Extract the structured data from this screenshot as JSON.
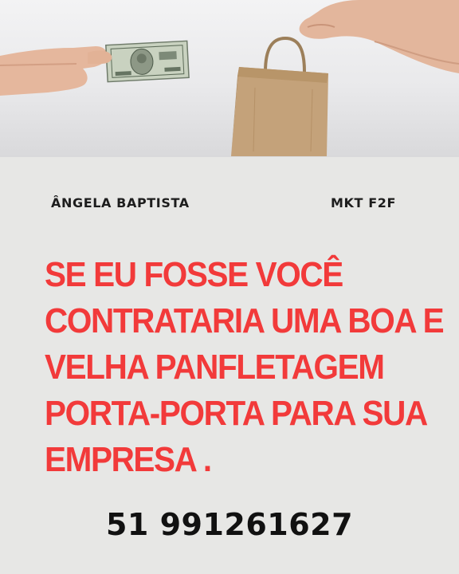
{
  "header_photo": {
    "description_icons": [
      "hand-with-banknote-icon",
      "hand-with-shopping-bag-icon"
    ]
  },
  "names": {
    "left": "ÂNGELA BAPTISTA",
    "right": "MKT F2F"
  },
  "headline": {
    "lines": [
      "SE EU FOSSE VOCÊ",
      "CONTRATARIA UMA BOA E",
      "VELHA PANFLETAGEM",
      "PORTA-PORTA PARA SUA",
      "EMPRESA ."
    ]
  },
  "phone": "51 991261627",
  "colors": {
    "headline": "#f23a3a",
    "text": "#1d1d1d",
    "background": "#e7e7e5"
  }
}
